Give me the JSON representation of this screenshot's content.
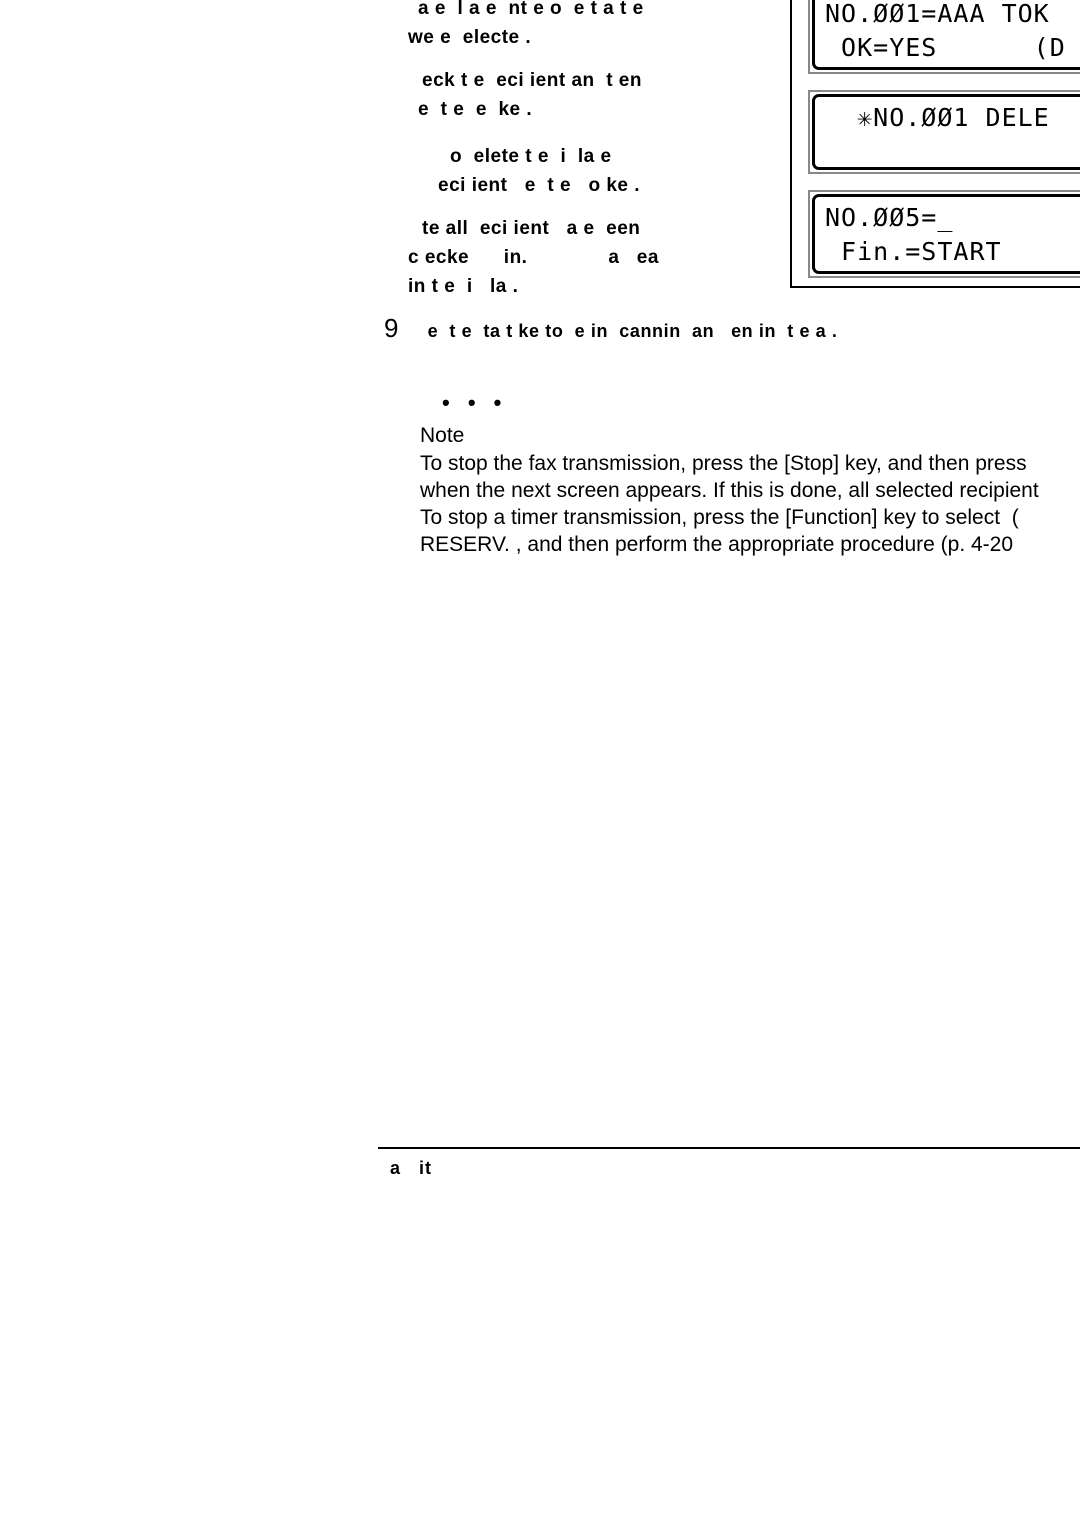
{
  "page": {
    "background_color": "#ffffff",
    "text_color": "#000000"
  },
  "body_copy": {
    "lines": [
      "a e  l a e  nt e o  e t a t e",
      "we e  electe .",
      "eck t e  eci ient an  t en",
      "e  t e  e  ke .",
      "o  elete t e  i  la e",
      "eci ient   e  t e   o ke .",
      "te all  eci ient   a e  een",
      "c ecke      in.              a   ea",
      "in t e  i   la ."
    ]
  },
  "step": {
    "number": "9",
    "text": " e  t e  ta t ke to  e in  cannin  an   en in  t e a ."
  },
  "note": {
    "dots": "• • •",
    "title": "Note",
    "lines": [
      "To stop the fax transmission, press the [Stop] key, and then press",
      "when the next screen appears. If this is done, all selected recipient",
      "To stop a timer transmission, press the [Function] key to select  (",
      "RESERV. , and then perform the appropriate procedure (p. 4-20"
    ]
  },
  "lcd_panels": [
    {
      "id": "lcd-recipient-confirm",
      "line1": "NO.ØØ1=AAA TOK",
      "line2": " OK=YES      (D"
    },
    {
      "id": "lcd-delete-confirm",
      "line1": "  ✳NO.ØØ1 DELE",
      "line2": ""
    },
    {
      "id": "lcd-next-entry",
      "line1": "NO.ØØ5=_",
      "line2": " Fin.=START"
    }
  ],
  "footer": {
    "text": "a   it"
  }
}
